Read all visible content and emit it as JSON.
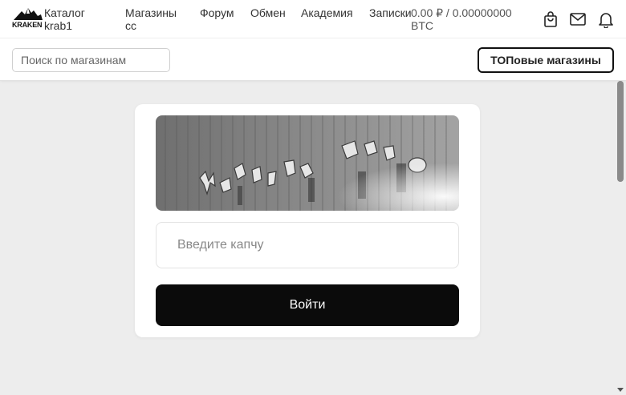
{
  "header": {
    "logo_text": "KRAKEN",
    "nav": {
      "catalog": "Каталог krab1",
      "shops": "Магазины cc",
      "forum": "Форум",
      "exchange": "Обмен",
      "academy": "Академия",
      "notes": "Записки"
    },
    "balance": "0.00 ₽ / 0.00000000 BTC",
    "icons": [
      "bag-icon",
      "mail-icon",
      "bell-icon"
    ]
  },
  "toolbar": {
    "search_placeholder": "Поиск по магазинам",
    "top_shops_label": "ТОПовые магазины"
  },
  "captcha": {
    "input_placeholder": "Введите капчу",
    "submit_label": "Войти"
  },
  "colors": {
    "page_background": "#ededed",
    "button_primary": "#0b0b0b",
    "accent": "#111111"
  }
}
